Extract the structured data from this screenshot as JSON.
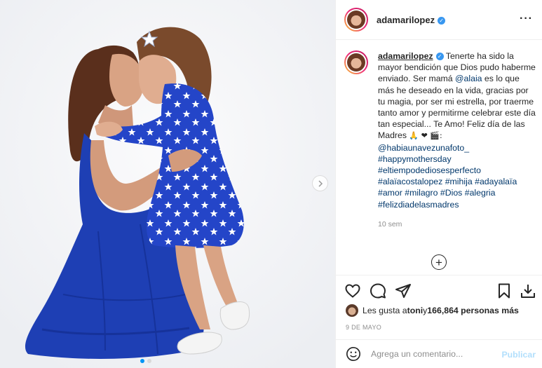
{
  "post": {
    "username": "adamarilopez",
    "verified": true
  },
  "caption": {
    "username": "adamarilopez",
    "text_1": "Tenerte ha sido la mayor bendición que Dios pudo haberme enviado. Ser mamá ",
    "mention_1": "@alaia",
    "text_2": " es lo que más he deseado en la vida, gracias por tu magia, por ser mi estrella, por traerme tanto amor y permitirme celebrar este día tan especial... Te Amo! Feliz día de las Madres ",
    "emoji": "🙏 ❤ 🎬:",
    "mention_2": "@habiaunavezunafoto_",
    "hashtags": [
      "#happymothersday",
      "#eltiempodediosesperfecto",
      "#alaïacostalopez",
      "#mihija",
      "#adayalaïa",
      "#amor",
      "#milagro",
      "#Dios",
      "#alegria",
      "#felizdiadelasmadres"
    ],
    "age": "10 sem"
  },
  "likes": {
    "prefix": "Les gusta a ",
    "user": "toni",
    "middle": " y ",
    "count": "166,864 personas más"
  },
  "date": "9 DE MAYO",
  "comment": {
    "placeholder": "Agrega un comentario...",
    "publish_label": "Publicar"
  },
  "icons": {
    "more": "more-options-icon",
    "like": "heart-icon",
    "comment": "comment-icon",
    "share": "share-icon",
    "save": "bookmark-icon",
    "download": "download-icon",
    "emoji": "smile-icon",
    "load_more": "plus-circle-icon",
    "next": "chevron-right-icon"
  },
  "colors": {
    "verified": "#3897f0",
    "link": "#00376b",
    "publish_disabled": "#b2dffc",
    "dress_blue": "#1e3fb4"
  }
}
